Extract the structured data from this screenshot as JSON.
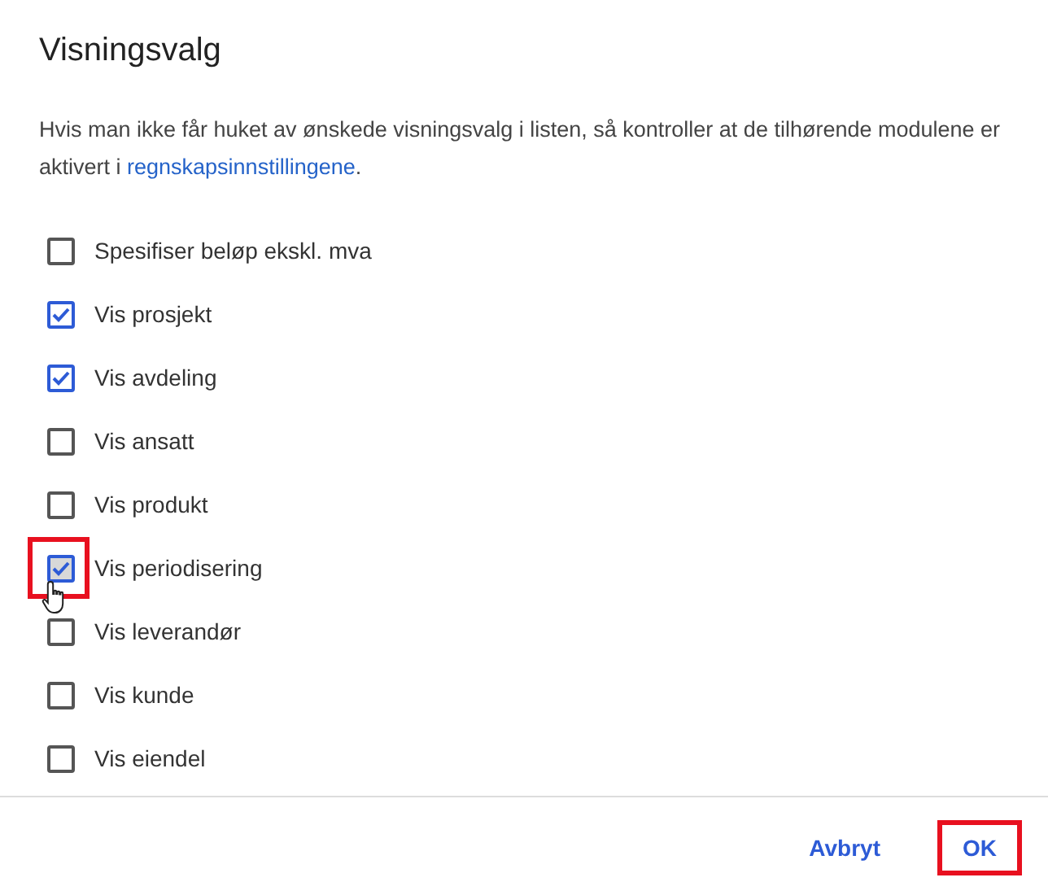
{
  "dialog": {
    "title": "Visningsvalg",
    "description": "Hvis man ikke får huket av ønskede visningsvalg i listen, så kontroller at de tilhørende modulene er aktivert i ",
    "description_link": "regnskapsinnstillingene",
    "description_end": ".",
    "options": [
      {
        "label": "Spesifiser beløp ekskl. mva",
        "checked": false,
        "highlighted": false
      },
      {
        "label": "Vis prosjekt",
        "checked": true,
        "highlighted": false
      },
      {
        "label": "Vis avdeling",
        "checked": true,
        "highlighted": false
      },
      {
        "label": "Vis ansatt",
        "checked": false,
        "highlighted": false
      },
      {
        "label": "Vis produkt",
        "checked": false,
        "highlighted": false
      },
      {
        "label": "Vis periodisering",
        "checked": true,
        "highlighted": true
      },
      {
        "label": "Vis leverandør",
        "checked": false,
        "highlighted": false
      },
      {
        "label": "Vis kunde",
        "checked": false,
        "highlighted": false
      },
      {
        "label": "Vis eiendel",
        "checked": false,
        "highlighted": false
      }
    ],
    "buttons": [
      {
        "label": "Avbryt",
        "highlighted": false
      },
      {
        "label": "OK",
        "highlighted": true
      }
    ]
  }
}
